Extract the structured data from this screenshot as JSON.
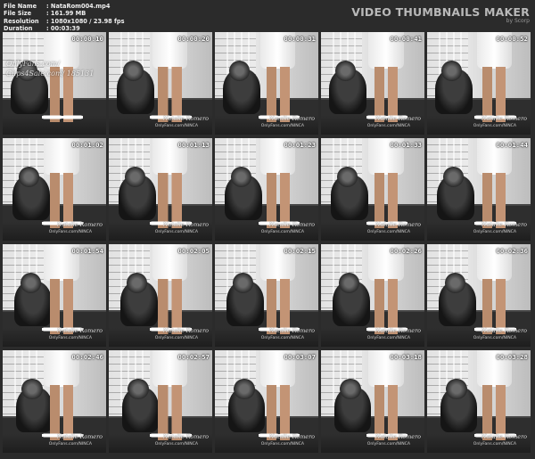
{
  "header": {
    "fields": [
      {
        "key": "File Name",
        "value": ": NataRom004.mp4"
      },
      {
        "key": "File Size",
        "value": ": 161.99 MB"
      },
      {
        "key": "Resolution",
        "value": ": 1080x1080 / 23.98 fps"
      },
      {
        "key": "Duration",
        "value": ": 00:03:39"
      }
    ],
    "brand_title": "VIDEO THUMBNAILS MAKER",
    "brand_sub": "by Scorp"
  },
  "thumbnails": [
    {
      "timestamp": "00:00:10"
    },
    {
      "timestamp": "00:00:20"
    },
    {
      "timestamp": "00:00:31"
    },
    {
      "timestamp": "00:00:41"
    },
    {
      "timestamp": "00:00:52"
    },
    {
      "timestamp": "00:01:02"
    },
    {
      "timestamp": "00:01:13"
    },
    {
      "timestamp": "00:01:23"
    },
    {
      "timestamp": "00:01:33"
    },
    {
      "timestamp": "00:01:44"
    },
    {
      "timestamp": "00:01:54"
    },
    {
      "timestamp": "00:02:05"
    },
    {
      "timestamp": "00:02:15"
    },
    {
      "timestamp": "00:02:26"
    },
    {
      "timestamp": "00:02:36"
    },
    {
      "timestamp": "00:02:46"
    },
    {
      "timestamp": "00:02:57"
    },
    {
      "timestamp": "00:03:07"
    },
    {
      "timestamp": "00:03:18"
    },
    {
      "timestamp": "00:03:28"
    }
  ],
  "first_overlay": {
    "line1": "OnlyFans.com/",
    "line2": "Clips4Sale.com/ 185131"
  },
  "watermark": {
    "signature": "Natalie Romero",
    "sub": "OnlyFans.com/NINCA"
  }
}
